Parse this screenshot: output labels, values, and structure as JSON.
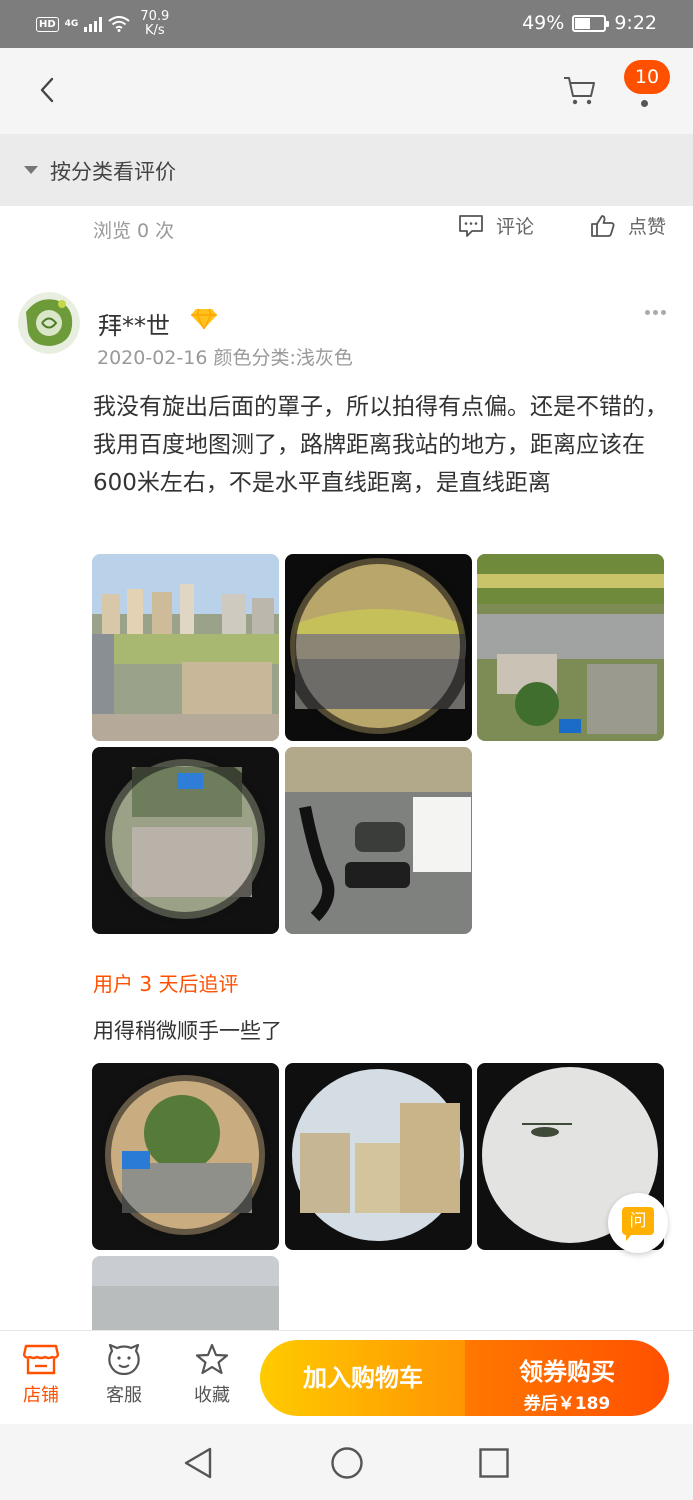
{
  "status_bar": {
    "hd": "HD",
    "network": "4G",
    "speed_value": "70.9",
    "speed_unit": "K/s",
    "battery_percent": "49%",
    "battery_level": 0.49,
    "time": "9:22"
  },
  "nav": {
    "message_count": "10"
  },
  "category": {
    "label": "按分类看评价"
  },
  "stats": {
    "views": "浏览 0 次",
    "comment_label": "评论",
    "like_label": "点赞"
  },
  "review": {
    "username": "拜**世",
    "meta": "2020-02-16 颜色分类:浅灰色",
    "text": "我没有旋出后面的罩子，所以拍得有点偏。还是不错的，我用百度地图测了，路牌距离我站的地方，距离应该在600米左右，不是水平直线距离，是直线距离",
    "followup_label": "用户 3 天后追评",
    "followup_text": "用得稍微顺手一些了"
  },
  "ask": {
    "label": "问"
  },
  "bottom_bar": {
    "shop_label": "店铺",
    "service_label": "客服",
    "favorite_label": "收藏",
    "add_cart_label": "加入购物车",
    "buy_label": "领券购买",
    "buy_sub_label": "券后￥189"
  },
  "colors": {
    "accent": "#ff5000",
    "cart_button": "#ffb000",
    "status_bar": "#7d7d7d"
  }
}
